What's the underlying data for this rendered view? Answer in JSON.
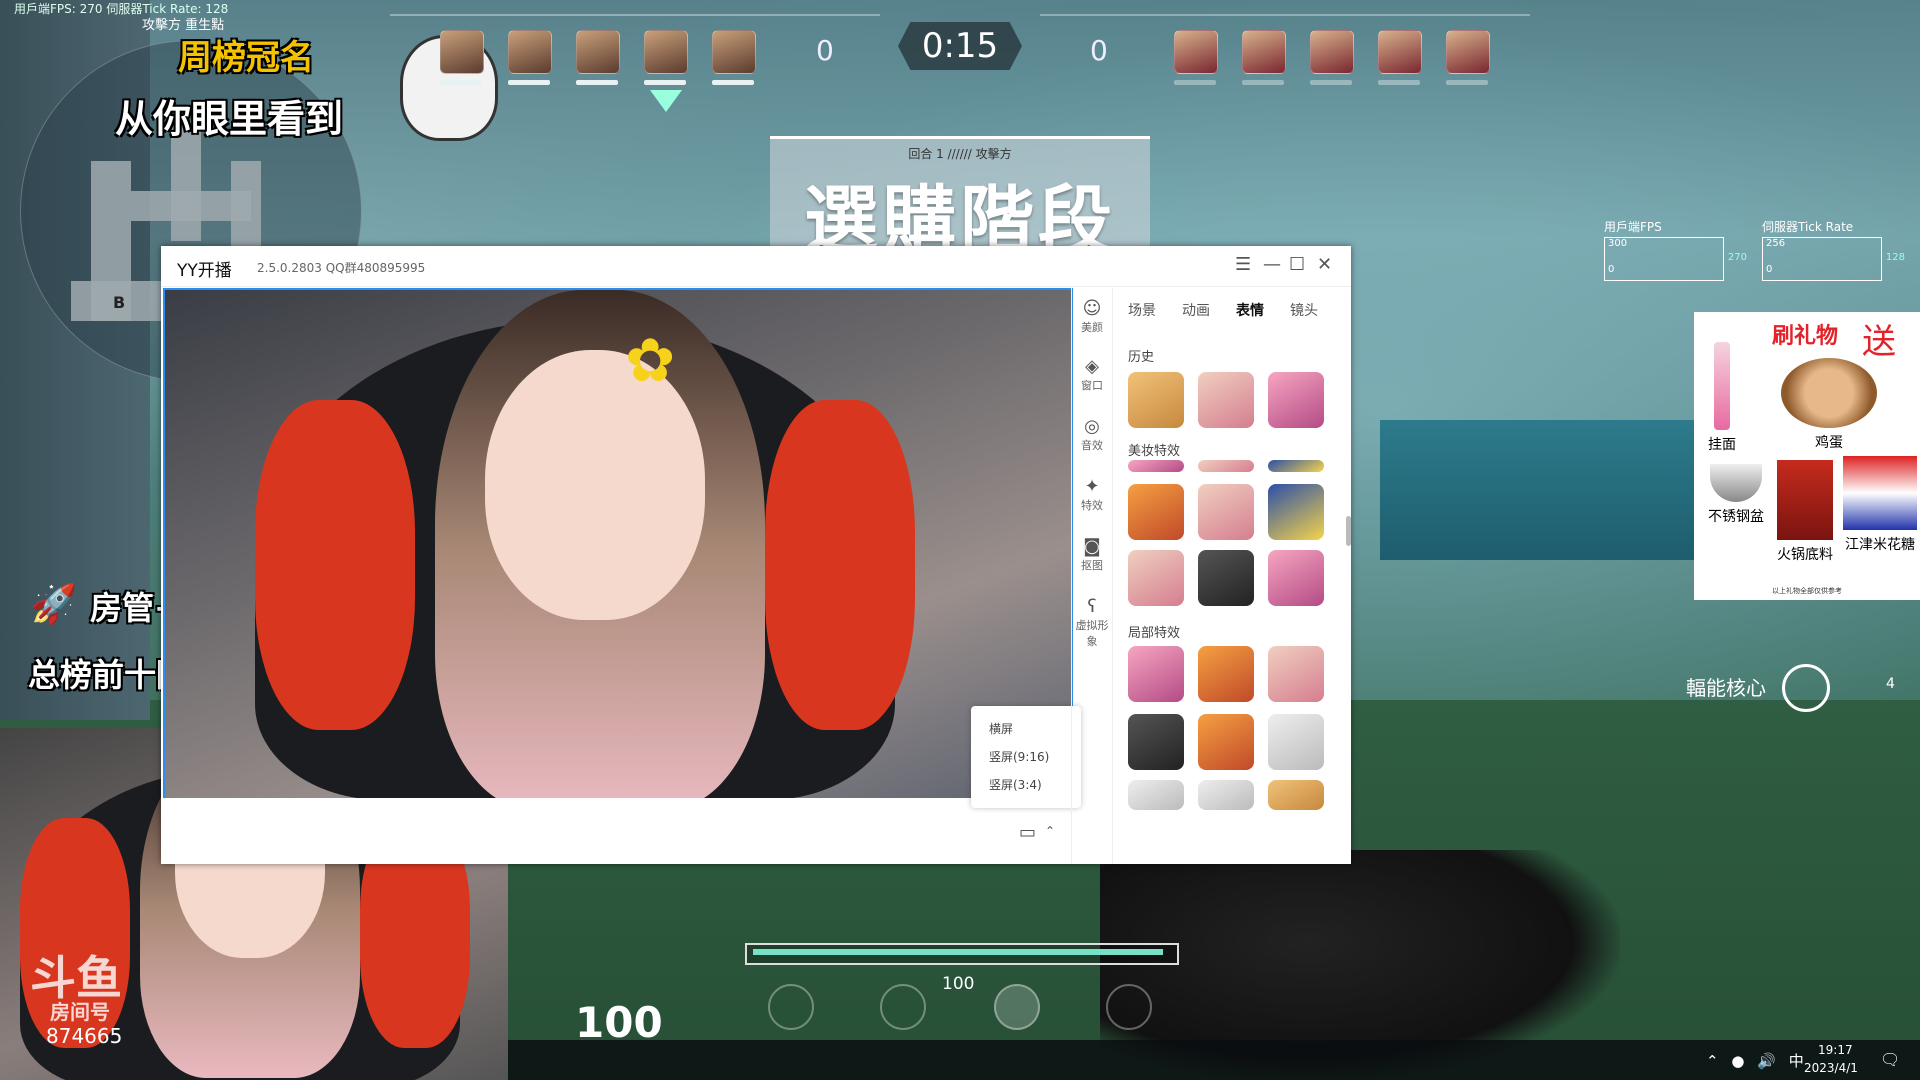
{
  "hud": {
    "fps_top": "用戶端FPS: 270   伺服器Tick Rate: 128",
    "attacker_text": "攻擊方 重生點",
    "score_left": "0",
    "score_right": "0",
    "timer": "0:15",
    "phase_sub": "回合 1 ////// 攻擊方",
    "phase_title": "選購階段",
    "minimap_marker": "B",
    "fps_graph_title": "用戶端FPS",
    "fps_graph_top": "300",
    "fps_graph_bottom": "0",
    "fps_graph_side": "270",
    "tick_graph_title": "伺服器Tick Rate",
    "tick_graph_top": "256",
    "tick_graph_bottom": "0",
    "tick_graph_side": "128",
    "core_text": "輻能核心",
    "core_count": "4",
    "hp": "100",
    "ability_value": "100",
    "ability_fill_fraction": 0.98,
    "accent": "#76e1c6"
  },
  "overlays": {
    "sticker1": "周榜冠名",
    "sticker2": "从你眼里看到",
    "sticker3": "房管+VX",
    "sticker4": "总榜前十随时上车"
  },
  "gift": {
    "title": "刷礼物",
    "send": "送",
    "items": [
      "挂面",
      "鸡蛋",
      "不锈钢盆",
      "火锅底料",
      "江津米花糖"
    ],
    "footer": "以上礼物全部仅供参考"
  },
  "yy": {
    "title": "YY开播",
    "version": "2.5.0.2803 QQ群480895995",
    "controls": {
      "menu": "☰",
      "minimize": "—",
      "maximize": "☐",
      "close": "✕"
    },
    "sidebar": [
      "美颜",
      "窗口",
      "音效",
      "特效",
      "抠图",
      "虚拟形象"
    ],
    "tabs": [
      "场景",
      "动画",
      "表情",
      "镜头"
    ],
    "active_tab": "表情",
    "sections": [
      "历史",
      "美妆特效",
      "局部特效"
    ],
    "layout_menu": [
      "横屏",
      "竖屏(9:16)",
      "竖屏(3:4)"
    ]
  },
  "douyu": {
    "logo": "斗鱼",
    "room_label": "房间号",
    "room_id": "874665"
  },
  "clock": {
    "time": "19:17",
    "date": "2023/4/1",
    "ime": "中"
  }
}
